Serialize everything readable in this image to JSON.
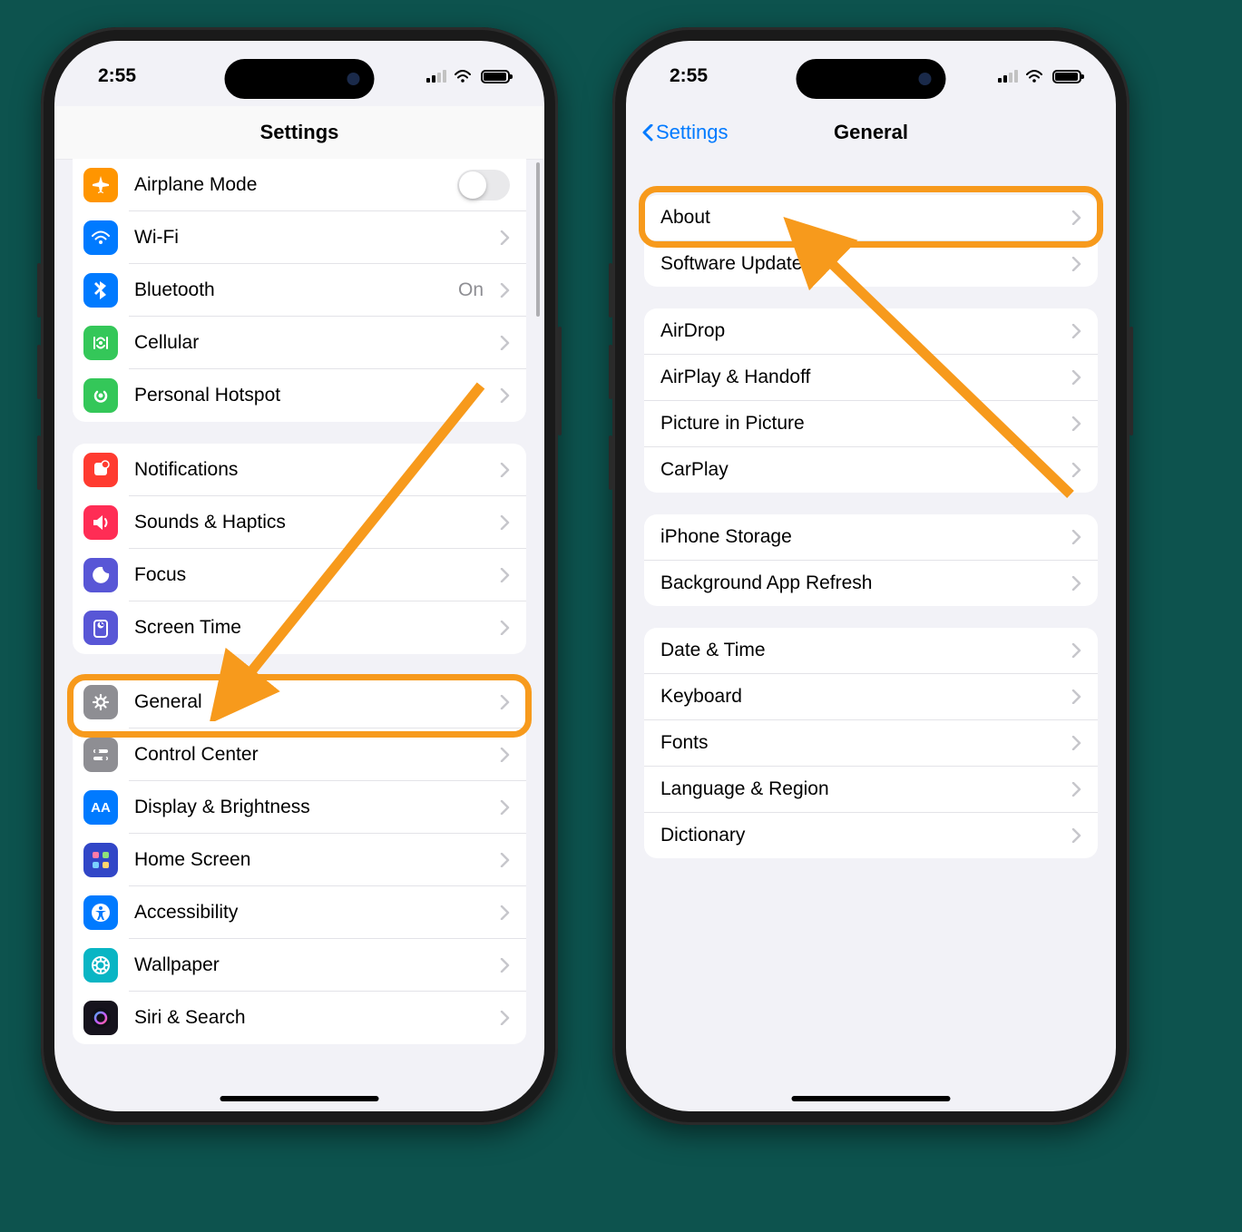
{
  "status": {
    "time": "2:55",
    "signal_bars": 2
  },
  "phone1": {
    "nav_title": "Settings",
    "group1": [
      {
        "id": "airplane",
        "label": "Airplane Mode",
        "color": "#ff9500",
        "control": "toggle",
        "toggle": false
      },
      {
        "id": "wifi",
        "label": "Wi-Fi",
        "color": "#007aff",
        "detail": ""
      },
      {
        "id": "bluetooth",
        "label": "Bluetooth",
        "color": "#007aff",
        "detail": "On"
      },
      {
        "id": "cellular",
        "label": "Cellular",
        "color": "#34c759"
      },
      {
        "id": "hotspot",
        "label": "Personal Hotspot",
        "color": "#34c759"
      }
    ],
    "group2": [
      {
        "id": "notifications",
        "label": "Notifications",
        "color": "#ff3b30"
      },
      {
        "id": "sounds",
        "label": "Sounds & Haptics",
        "color": "#ff3b30"
      },
      {
        "id": "focus",
        "label": "Focus",
        "color": "#5856d6"
      },
      {
        "id": "screentime",
        "label": "Screen Time",
        "color": "#5856d6"
      }
    ],
    "group3": [
      {
        "id": "general",
        "label": "General",
        "color": "#8e8e93",
        "highlight": true
      },
      {
        "id": "controlcenter",
        "label": "Control Center",
        "color": "#8e8e93"
      },
      {
        "id": "display",
        "label": "Display & Brightness",
        "color": "#007aff"
      },
      {
        "id": "homescreen",
        "label": "Home Screen",
        "color": "#3146c7"
      },
      {
        "id": "accessibility",
        "label": "Accessibility",
        "color": "#007aff"
      },
      {
        "id": "wallpaper",
        "label": "Wallpaper",
        "color": "#09b5c4"
      },
      {
        "id": "siri",
        "label": "Siri & Search",
        "color": "#2a2732"
      }
    ]
  },
  "phone2": {
    "nav_title": "General",
    "back_label": "Settings",
    "group1": [
      {
        "id": "about",
        "label": "About",
        "highlight": true
      },
      {
        "id": "swupdate",
        "label": "Software Update"
      }
    ],
    "group2": [
      {
        "id": "airdrop",
        "label": "AirDrop"
      },
      {
        "id": "airplay",
        "label": "AirPlay & Handoff"
      },
      {
        "id": "pip",
        "label": "Picture in Picture"
      },
      {
        "id": "carplay",
        "label": "CarPlay"
      }
    ],
    "group3": [
      {
        "id": "storage",
        "label": "iPhone Storage"
      },
      {
        "id": "bgrefresh",
        "label": "Background App Refresh"
      }
    ],
    "group4": [
      {
        "id": "datetime",
        "label": "Date & Time"
      },
      {
        "id": "keyboard",
        "label": "Keyboard"
      },
      {
        "id": "fonts",
        "label": "Fonts"
      },
      {
        "id": "language",
        "label": "Language & Region"
      },
      {
        "id": "dictionary",
        "label": "Dictionary"
      }
    ]
  },
  "colors": {
    "highlight": "#f79a1c"
  }
}
